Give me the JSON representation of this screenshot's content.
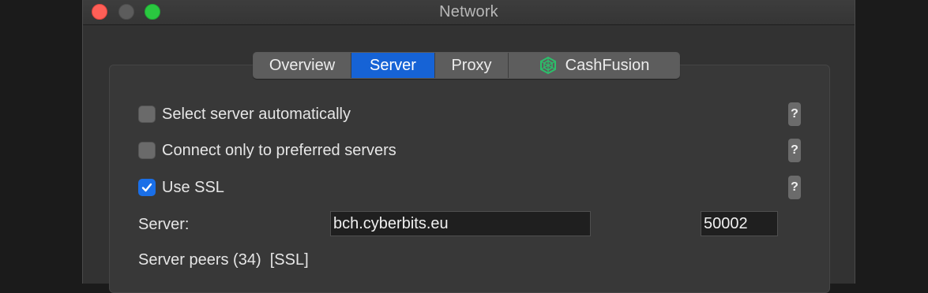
{
  "window": {
    "title": "Network"
  },
  "tabs": [
    {
      "label": "Overview",
      "active": false
    },
    {
      "label": "Server",
      "active": true
    },
    {
      "label": "Proxy",
      "active": false
    },
    {
      "label": "CashFusion",
      "active": false,
      "icon": "cashfusion-icon"
    }
  ],
  "options": {
    "auto_select": {
      "label": "Select server automatically",
      "checked": false,
      "help": "?"
    },
    "preferred_only": {
      "label": "Connect only to preferred servers",
      "checked": false,
      "help": "?"
    },
    "use_ssl": {
      "label": "Use SSL",
      "checked": true,
      "help": "?"
    }
  },
  "server": {
    "label": "Server:",
    "host": "bch.cyberbits.eu",
    "port": "50002"
  },
  "peers": {
    "label": "Server peers (34)  [SSL]"
  },
  "colors": {
    "accent": "#1663d6",
    "cashfusion_icon": "#2bbf6a",
    "close": "#fe5f57",
    "maximize": "#2ac840"
  }
}
